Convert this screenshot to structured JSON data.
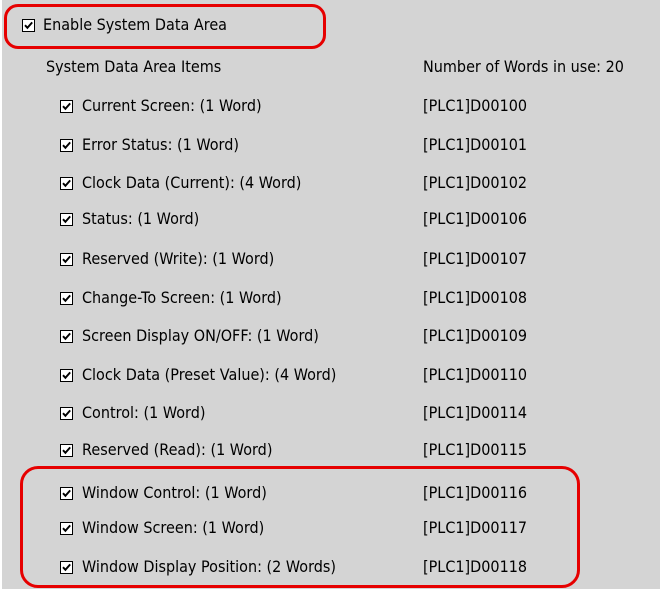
{
  "enable": {
    "label": "Enable System Data Area",
    "checked": true
  },
  "headers": {
    "items": "System Data Area Items",
    "words_in_use": "Number of Words in use: 20"
  },
  "items": [
    {
      "label": "Current Screen: (1 Word)",
      "address": "[PLC1]D00100",
      "checked": true
    },
    {
      "label": "Error Status: (1 Word)",
      "address": "[PLC1]D00101",
      "checked": true
    },
    {
      "label": "Clock Data (Current): (4 Word)",
      "address": "[PLC1]D00102",
      "checked": true
    },
    {
      "label": "Status: (1 Word)",
      "address": "[PLC1]D00106",
      "checked": true
    },
    {
      "label": "Reserved (Write): (1 Word)",
      "address": "[PLC1]D00107",
      "checked": true
    },
    {
      "label": "Change-To Screen: (1 Word)",
      "address": "[PLC1]D00108",
      "checked": true
    },
    {
      "label": "Screen Display ON/OFF: (1 Word)",
      "address": "[PLC1]D00109",
      "checked": true
    },
    {
      "label": "Clock Data (Preset Value): (4 Word)",
      "address": "[PLC1]D00110",
      "checked": true
    },
    {
      "label": "Control: (1 Word)",
      "address": "[PLC1]D00114",
      "checked": true
    },
    {
      "label": "Reserved (Read): (1 Word)",
      "address": "[PLC1]D00115",
      "checked": true
    },
    {
      "label": "Window Control: (1 Word)",
      "address": "[PLC1]D00116",
      "checked": true
    },
    {
      "label": "Window Screen: (1 Word)",
      "address": "[PLC1]D00117",
      "checked": true
    },
    {
      "label": "Window Display Position: (2 Words)",
      "address": "[PLC1]D00118",
      "checked": true
    }
  ],
  "colors": {
    "panel": "#d4d4d4",
    "highlight": "#e60000",
    "checkbox": "#ffffff"
  },
  "icons": {
    "check": "checkmark-icon"
  }
}
